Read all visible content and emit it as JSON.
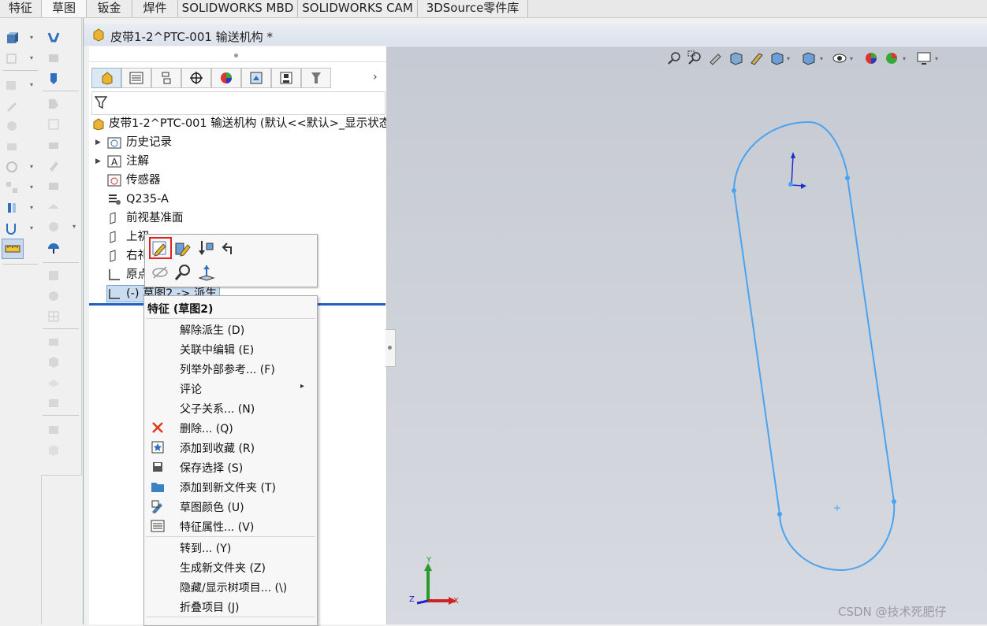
{
  "tabs": [
    "特征",
    "草图",
    "钣金",
    "焊件",
    "SOLIDWORKS MBD",
    "SOLIDWORKS CAM",
    "3DSource零件库"
  ],
  "active_tab": "草图",
  "document": {
    "title": "皮带1-2^PTC-001 输送机构 *"
  },
  "tree": {
    "root": "皮带1-2^PTC-001 输送机构  (默认<<默认>_显示状态",
    "items": [
      {
        "label": "历史记录",
        "icon": "history-icon",
        "expandable": true
      },
      {
        "label": "注解",
        "icon": "annotation-icon",
        "expandable": true
      },
      {
        "label": "传感器",
        "icon": "sensor-icon",
        "expandable": false
      },
      {
        "label": "Q235-A",
        "icon": "material-icon",
        "expandable": false
      },
      {
        "label": "前视基准面",
        "icon": "plane-icon",
        "expandable": false
      },
      {
        "label": "上视基准面",
        "icon": "plane-icon",
        "expandable": false
      },
      {
        "label": "右视基准面",
        "icon": "plane-icon",
        "expandable": false
      },
      {
        "label": "原点",
        "icon": "origin-icon",
        "expandable": false
      },
      {
        "label": "(-) 草图2 -> 派生",
        "icon": "sketch-icon",
        "expandable": false
      }
    ],
    "visible_fragments": {
      "top_plane": "上初",
      "right_plane": "右礼",
      "origin": "原点",
      "sketch": "(-) 草图2 -> 派生"
    }
  },
  "context_menu": {
    "header": "特征 (草图2)",
    "items": [
      {
        "label": "解除派生 (D)",
        "icon": ""
      },
      {
        "label": "关联中编辑 (E)",
        "icon": ""
      },
      {
        "label": "列举外部参考... (F)",
        "icon": ""
      },
      {
        "label": "评论",
        "icon": "",
        "submenu": "▸"
      },
      {
        "label": "父子关系... (N)",
        "icon": ""
      },
      {
        "label": "删除... (Q)",
        "icon": "delete-icon"
      },
      {
        "label": "添加到收藏 (R)",
        "icon": "favorite-icon"
      },
      {
        "label": "保存选择 (S)",
        "icon": "save-selection-icon"
      },
      {
        "label": "添加到新文件夹 (T)",
        "icon": "folder-icon"
      },
      {
        "label": "草图颜色 (U)",
        "icon": "sketch-color-icon"
      },
      {
        "label": "特征属性... (V)",
        "icon": "properties-icon"
      },
      {
        "label": "转到... (Y)",
        "icon": ""
      },
      {
        "label": "生成新文件夹 (Z)",
        "icon": ""
      },
      {
        "label": "隐藏/显示树项目... (\\)",
        "icon": ""
      },
      {
        "label": "折叠项目 (J)",
        "icon": ""
      }
    ]
  },
  "axes": {
    "y": "Y",
    "x": "X",
    "z": "Z"
  },
  "watermark": "CSDN @技术死肥仔",
  "colors": {
    "sketch": "#4aa3f0",
    "highlight": "#e22222",
    "rollback": "#1f5fbf"
  }
}
